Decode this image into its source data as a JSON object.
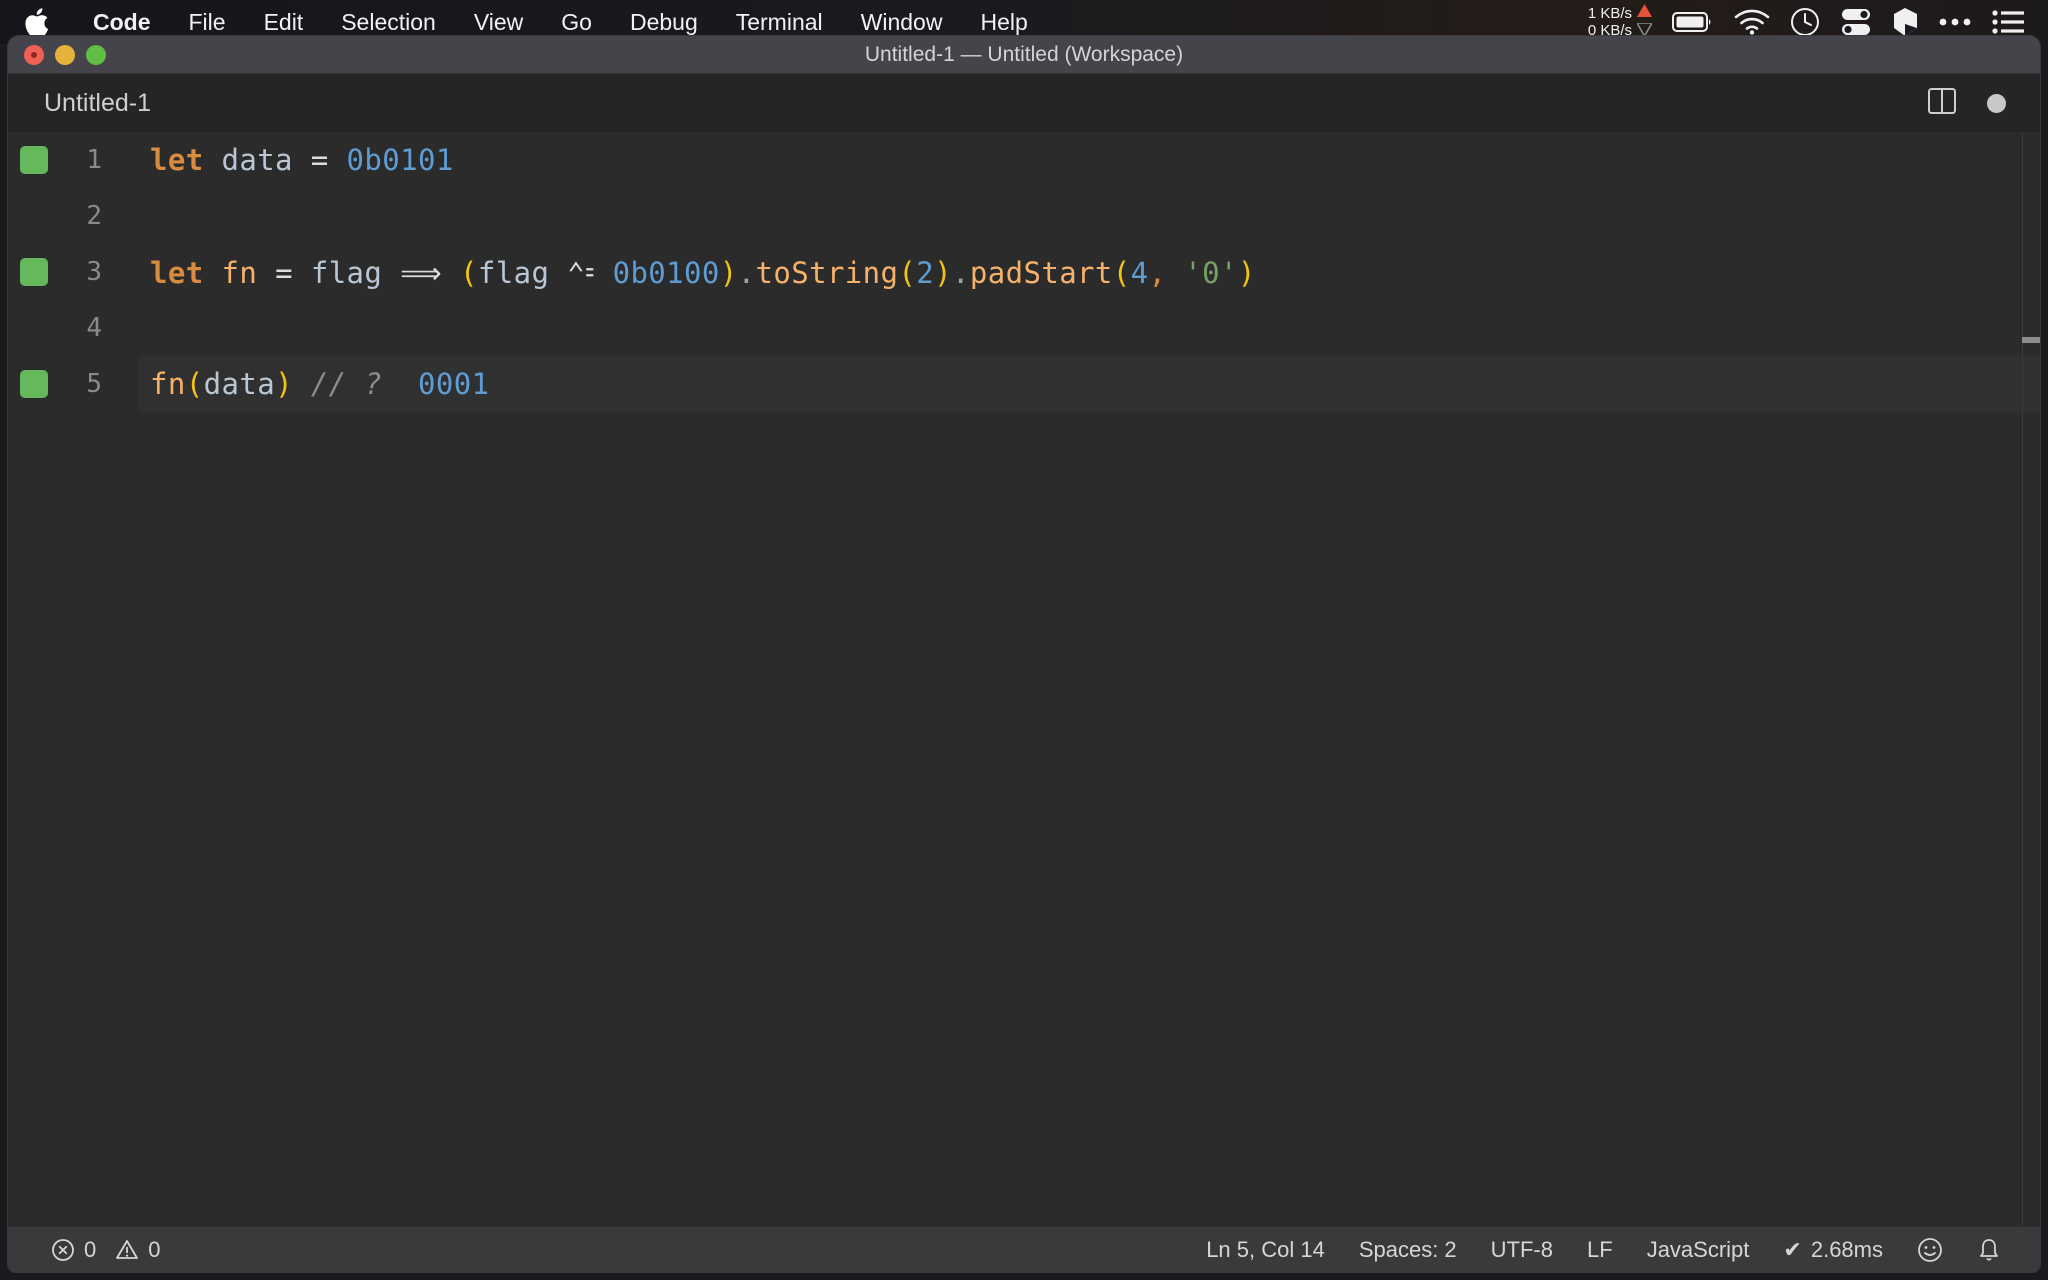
{
  "menubar": {
    "apple_icon": "apple-logo-icon",
    "items": [
      {
        "label": "Code",
        "bold": true
      },
      {
        "label": "File",
        "bold": false
      },
      {
        "label": "Edit",
        "bold": false
      },
      {
        "label": "Selection",
        "bold": false
      },
      {
        "label": "View",
        "bold": false
      },
      {
        "label": "Go",
        "bold": false
      },
      {
        "label": "Debug",
        "bold": false
      },
      {
        "label": "Terminal",
        "bold": false
      },
      {
        "label": "Window",
        "bold": false
      },
      {
        "label": "Help",
        "bold": false
      }
    ],
    "status": {
      "net_up": "1 KB/s",
      "net_down": "0 KB/s",
      "up_arrow_color": "#e8503a",
      "down_arrow_color": "#8a8a8c",
      "icons": [
        "battery-icon",
        "wifi-icon",
        "clock-icon",
        "toggles-icon",
        "shape-icon",
        "ellipsis-icon",
        "list-icon"
      ]
    }
  },
  "window": {
    "title": "Untitled-1 — Untitled (Workspace)",
    "traffic_lights": [
      "close-button",
      "minimize-button",
      "maximize-button"
    ]
  },
  "tabbar": {
    "active_tab": "Untitled-1",
    "split_editor_icon": "split-editor-icon",
    "dirty_indicator": "unsaved-dot-icon"
  },
  "editor": {
    "lines": [
      {
        "number": "1",
        "marker": true,
        "current": false,
        "tokens": [
          {
            "text": "let",
            "cls": "t-kw"
          },
          {
            "text": " ",
            "cls": "t-op"
          },
          {
            "text": "data",
            "cls": "t-var"
          },
          {
            "text": " ",
            "cls": "t-op"
          },
          {
            "text": "=",
            "cls": "t-op"
          },
          {
            "text": " ",
            "cls": "t-op"
          },
          {
            "text": "0b0101",
            "cls": "t-num"
          }
        ]
      },
      {
        "number": "2",
        "marker": false,
        "current": false,
        "tokens": []
      },
      {
        "number": "3",
        "marker": true,
        "current": false,
        "tokens": [
          {
            "text": "let",
            "cls": "t-kw"
          },
          {
            "text": " ",
            "cls": "t-op"
          },
          {
            "text": "fn",
            "cls": "t-fnname"
          },
          {
            "text": " ",
            "cls": "t-op"
          },
          {
            "text": "=",
            "cls": "t-op"
          },
          {
            "text": " ",
            "cls": "t-op"
          },
          {
            "text": "flag",
            "cls": "t-var"
          },
          {
            "text": " ",
            "cls": "t-op"
          },
          {
            "text": "⟹",
            "cls": "t-op"
          },
          {
            "text": " ",
            "cls": "t-op"
          },
          {
            "text": "(",
            "cls": "t-paren"
          },
          {
            "text": "flag",
            "cls": "t-var"
          },
          {
            "text": " ",
            "cls": "t-op"
          },
          {
            "text": "⌃⹀",
            "cls": "t-op"
          },
          {
            "text": " ",
            "cls": "t-op"
          },
          {
            "text": "0b0100",
            "cls": "t-num"
          },
          {
            "text": ")",
            "cls": "t-paren"
          },
          {
            "text": ".",
            "cls": "t-dot"
          },
          {
            "text": "toString",
            "cls": "t-fnname"
          },
          {
            "text": "(",
            "cls": "t-paren"
          },
          {
            "text": "2",
            "cls": "t-num"
          },
          {
            "text": ")",
            "cls": "t-paren"
          },
          {
            "text": ".",
            "cls": "t-dot"
          },
          {
            "text": "padStart",
            "cls": "t-fnname"
          },
          {
            "text": "(",
            "cls": "t-paren"
          },
          {
            "text": "4",
            "cls": "t-num"
          },
          {
            "text": ",",
            "cls": "t-comma"
          },
          {
            "text": " ",
            "cls": "t-op"
          },
          {
            "text": "'0'",
            "cls": "t-str"
          },
          {
            "text": ")",
            "cls": "t-paren"
          }
        ]
      },
      {
        "number": "4",
        "marker": false,
        "current": false,
        "tokens": []
      },
      {
        "number": "5",
        "marker": true,
        "current": true,
        "tokens": [
          {
            "text": "fn",
            "cls": "t-fnname"
          },
          {
            "text": "(",
            "cls": "t-paren"
          },
          {
            "text": "data",
            "cls": "t-var"
          },
          {
            "text": ")",
            "cls": "t-paren"
          },
          {
            "text": " ",
            "cls": "t-op"
          },
          {
            "text": "// ?",
            "cls": "t-comment"
          },
          {
            "text": "  ",
            "cls": "t-op"
          },
          {
            "text": "0001",
            "cls": "t-quokka"
          }
        ]
      }
    ],
    "source_text": "let data = 0b0101\n\nlet fn = flag => (flag ^= 0b0100).toString(2).padStart(4, '0')\n\nfn(data) // ?  0001"
  },
  "statusbar": {
    "errors": "0",
    "warnings": "0",
    "error_icon": "error-circle-icon",
    "warning_icon": "warning-triangle-icon",
    "cursor_position": "Ln 5, Col 14",
    "indentation": "Spaces: 2",
    "encoding": "UTF-8",
    "eol": "LF",
    "language": "JavaScript",
    "runtime": "2.68ms",
    "runtime_check": "✔",
    "feedback_icon": "smiley-icon",
    "bell_icon": "bell-icon"
  },
  "colors": {
    "editor_bg": "#2b2b2b",
    "statusbar_bg": "#3a3a3c",
    "titlebar_bg": "#44444a",
    "marker_green": "#63b95b",
    "accent_orange": "#d98b3f",
    "accent_blue": "#5e9cd3",
    "accent_yellow": "#f2c412"
  }
}
